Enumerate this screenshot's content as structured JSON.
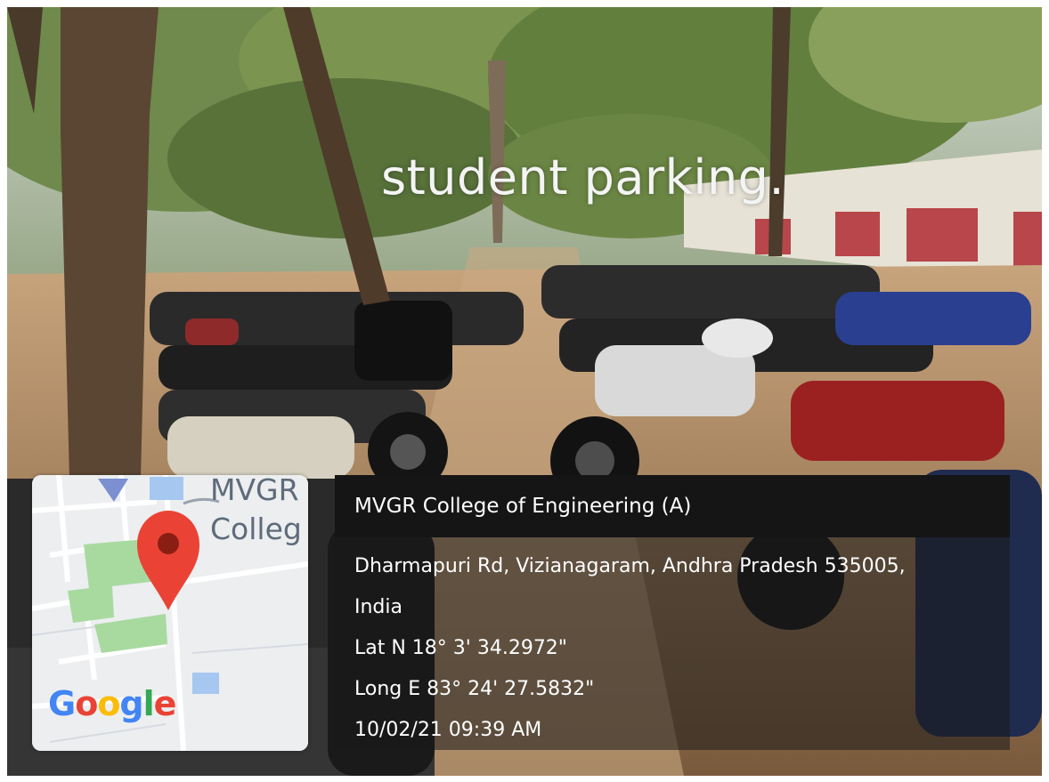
{
  "caption": "student parking.",
  "map": {
    "label_line1": "MVGR",
    "label_line2": "Colleg",
    "logo": {
      "letters": [
        "G",
        "o",
        "o",
        "g",
        "l",
        "e"
      ],
      "colors": [
        "#4285F4",
        "#EA4335",
        "#FBBC05",
        "#4285F4",
        "#34A853",
        "#EA4335"
      ]
    },
    "pin_color": "#EA4335",
    "park_color": "#A8DAA0"
  },
  "info": {
    "title": "MVGR College of Engineering (A)",
    "address_line1": "Dharmapuri Rd, Vizianagaram, Andhra Pradesh 535005,",
    "address_line2": "India",
    "lat": "Lat N 18° 3' 34.2972\"",
    "long": "Long E 83° 24' 27.5832\"",
    "datetime": "10/02/21 09:39 AM"
  }
}
